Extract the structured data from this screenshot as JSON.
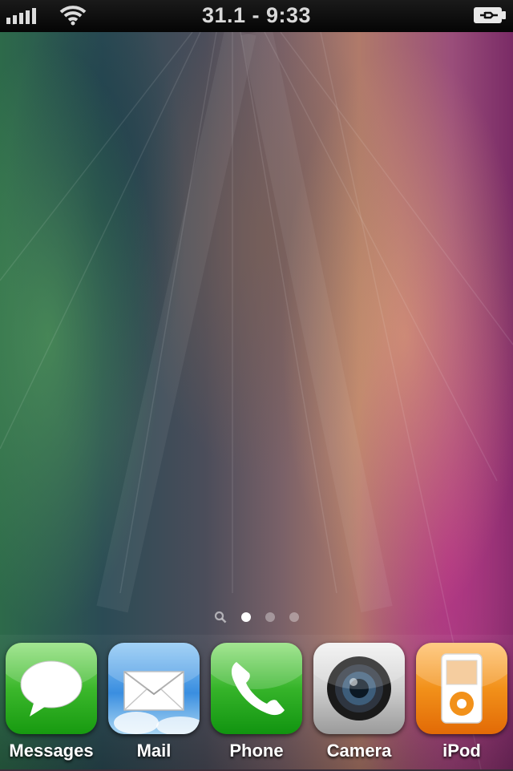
{
  "status_bar": {
    "signal_bars": 5,
    "wifi": true,
    "clock": "31.1 - 9:33",
    "battery_state": "charging"
  },
  "home": {
    "page_count": 3,
    "current_page": 1,
    "spotlight_icon": "search-icon"
  },
  "dock": {
    "apps": [
      {
        "label": "Messages",
        "icon": "messages-icon"
      },
      {
        "label": "Mail",
        "icon": "mail-icon"
      },
      {
        "label": "Phone",
        "icon": "phone-icon"
      },
      {
        "label": "Camera",
        "icon": "camera-icon"
      },
      {
        "label": "iPod",
        "icon": "ipod-icon"
      }
    ]
  },
  "colors": {
    "status_bar_bg": "#000000",
    "label_text": "#ffffff",
    "messages_green": "#3cb82c",
    "mail_blue": "#3a8ee0",
    "ipod_orange": "#f2911a"
  }
}
